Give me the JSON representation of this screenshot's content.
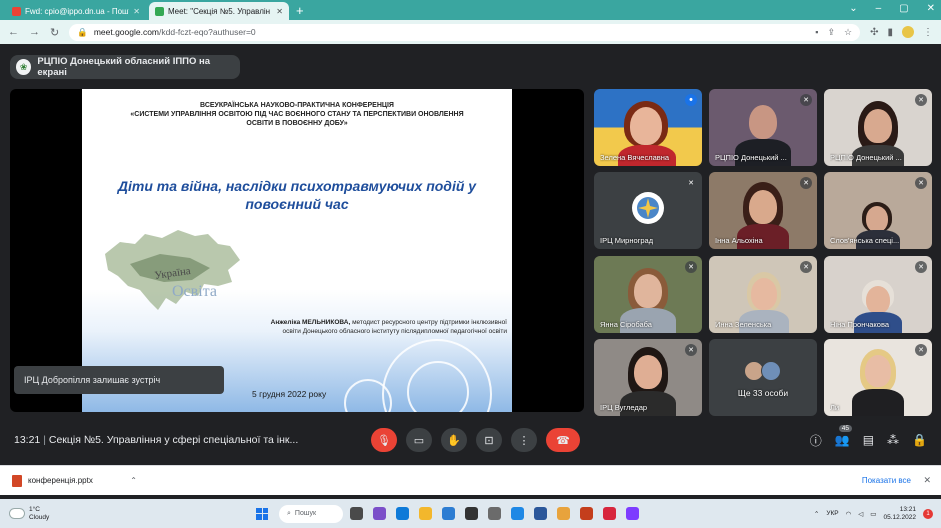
{
  "browser": {
    "tabs": [
      {
        "title": "Fwd: cpio@ippo.dn.ua - Пошт",
        "icon": "gmail-icon",
        "color": "#ea4335",
        "active": false
      },
      {
        "title": "Meet: \"Секція №5. Управлін",
        "icon": "meet-icon",
        "color": "#34a853",
        "active": true
      }
    ],
    "url_host": "meet.google.com",
    "url_path": "/kdd-fczt-eqo?authuser=0"
  },
  "meeting": {
    "presenter_label": "РЦПІО Донецький обласний ІППО на екрані",
    "time": "13:21",
    "title": "Секція №5. Управління у сфері спеціальної та інк...",
    "participants_count": "45",
    "toast": "ІРЦ Добропілля залишає зустріч"
  },
  "slide": {
    "conference": "ВСЕУКРАЇНСЬКА НАУКОВО-ПРАКТИЧНА КОНФЕРЕНЦІЯ",
    "conference_subtitle": "«СИСТЕМИ УПРАВЛІННЯ ОСВІТОЮ ПІД ЧАС ВОЄННОГО СТАНУ ТА ПЕРСПЕКТИВИ ОНОВЛЕННЯ ОСВІТИ В ПОВОЄННУ ДОБУ»",
    "theme": "Діти та війна, наслідки психотравмуючих подій у повоєнний час",
    "author_name": "Анжеліка МЕЛЬНИКОВА,",
    "author_role": "методист ресурсного центру підтримки інклюзивної освіти Донецького обласного інституту післядипломної педагогічної освіти",
    "map_words": [
      "Україна",
      "Освіта"
    ],
    "date": "5 грудня 2022 року"
  },
  "participants": [
    {
      "name": "Зелена Вячеславна",
      "speaking": true
    },
    {
      "name": "РЦПІО Донецький ...",
      "speaking": false
    },
    {
      "name": "РЦПІО Донецький ...",
      "speaking": false
    },
    {
      "name": "ІРЦ Мирноград",
      "speaking": false
    },
    {
      "name": "Інна Альохіна",
      "speaking": false
    },
    {
      "name": "Слов'янська спеці...",
      "speaking": false
    },
    {
      "name": "Янна Сіробаба",
      "speaking": false
    },
    {
      "name": "Инна Зеленська",
      "speaking": false
    },
    {
      "name": "Ніна Прончакова",
      "speaking": false
    },
    {
      "name": "ІРЦ Вугледар",
      "speaking": false
    },
    {
      "name": "Ще 33 особи",
      "speaking": false
    },
    {
      "name": "Ли",
      "speaking": false
    }
  ],
  "download": {
    "file": "конференція.pptx",
    "show_all": "Показати все"
  },
  "taskbar": {
    "temp": "1°C",
    "weather": "Cloudy",
    "search": "Пошук",
    "lang": "УКР",
    "time": "13:21",
    "date": "05.12.2022",
    "notif": "1"
  }
}
